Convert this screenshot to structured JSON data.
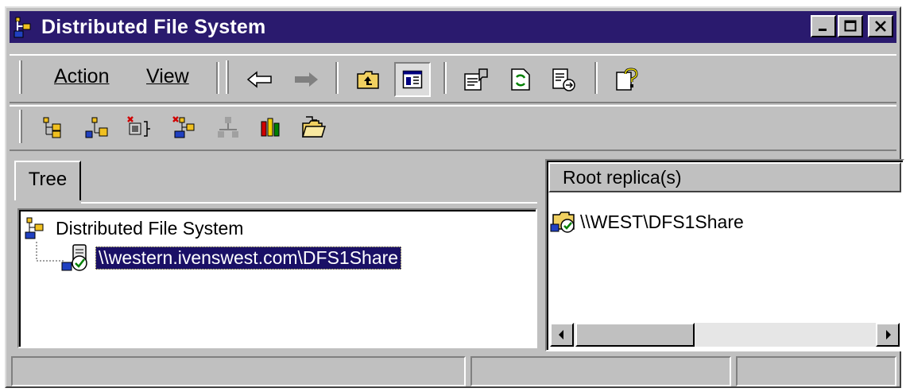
{
  "window": {
    "title": "Distributed File System",
    "title_bar_color": "#2a1a6e",
    "icon": "dfs-root-icon",
    "controls": [
      "minimize-icon",
      "maximize-icon",
      "close-icon"
    ]
  },
  "menubar": {
    "action_label": "Action",
    "view_label": "View"
  },
  "toolbar1": {
    "icons": [
      "back-arrow-icon",
      "forward-arrow-icon",
      "up-folder-icon",
      "show-hide-tree-icon",
      "properties-icon",
      "refresh-icon",
      "export-list-icon",
      "help-icon"
    ]
  },
  "toolbar2": {
    "icons": [
      "new-dfs-root-icon",
      "new-dfs-link-icon",
      "delete-root-icon",
      "remove-display-icon",
      "replication-policy-icon",
      "status-chart-icon",
      "open-folder-icon"
    ]
  },
  "tree_panel": {
    "tab_label": "Tree",
    "root_label": "Distributed File System",
    "child_label": "\\\\western.ivenswest.com\\DFS1Share",
    "selection_color": "#1a1066"
  },
  "right_panel": {
    "column_header": "Root replica(s)",
    "items": [
      "\\\\WEST\\DFS1Share"
    ]
  }
}
